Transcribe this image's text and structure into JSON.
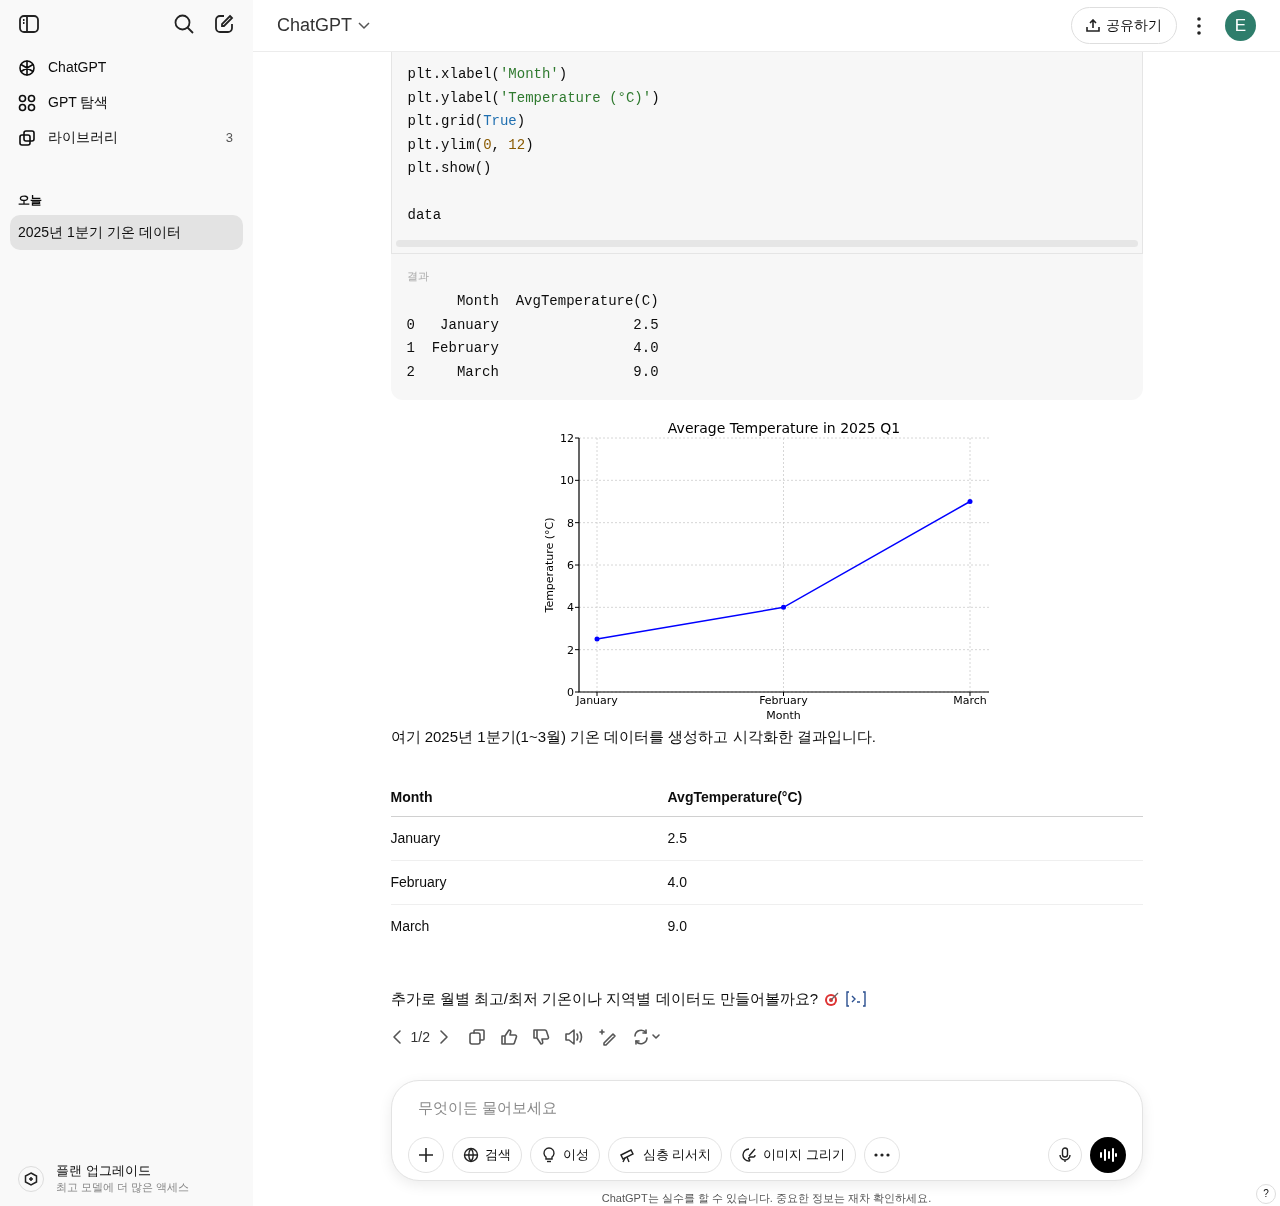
{
  "sidebar": {
    "nav": [
      {
        "label": "ChatGPT"
      },
      {
        "label": "GPT 탐색"
      },
      {
        "label": "라이브러리",
        "count": "3"
      }
    ],
    "section_label": "오늘",
    "chats": [
      {
        "title": "2025년 1분기 기온 데이터",
        "selected": true
      }
    ],
    "upgrade": {
      "title": "플랜 업그레이드",
      "subtitle": "최고 모델에 더 많은 액세스"
    }
  },
  "header": {
    "title": "ChatGPT",
    "share_label": "공유하기",
    "avatar_letter": "E"
  },
  "code": {
    "lines": [
      {
        "kind": "code",
        "tokens": [
          {
            "text": "plt.xlabel(",
            "kind": "plain"
          },
          {
            "text": "'Month'",
            "kind": "string"
          },
          {
            "text": ")",
            "kind": "plain"
          }
        ]
      },
      {
        "kind": "code",
        "tokens": [
          {
            "text": "plt.ylabel(",
            "kind": "plain"
          },
          {
            "text": "'Temperature (°C)'",
            "kind": "string"
          },
          {
            "text": ")",
            "kind": "plain"
          }
        ]
      },
      {
        "kind": "code",
        "tokens": [
          {
            "text": "plt.grid(",
            "kind": "plain"
          },
          {
            "text": "True",
            "kind": "keyword"
          },
          {
            "text": ")",
            "kind": "plain"
          }
        ]
      },
      {
        "kind": "code",
        "tokens": [
          {
            "text": "plt.ylim(",
            "kind": "plain"
          },
          {
            "text": "0",
            "kind": "number"
          },
          {
            "text": ", ",
            "kind": "plain"
          },
          {
            "text": "12",
            "kind": "number"
          },
          {
            "text": ")",
            "kind": "plain"
          }
        ]
      },
      {
        "kind": "code",
        "tokens": [
          {
            "text": "plt.show()",
            "kind": "plain"
          }
        ]
      },
      {
        "kind": "blank"
      },
      {
        "kind": "code",
        "tokens": [
          {
            "text": "data",
            "kind": "plain"
          }
        ]
      }
    ]
  },
  "result": {
    "label": "결과",
    "lines": [
      "      Month  AvgTemperature(C)",
      "0   January                2.5",
      "1  February                4.0",
      "2     March                9.0"
    ]
  },
  "chart_data": {
    "type": "line",
    "title": "Average Temperature in 2025 Q1",
    "xlabel": "Month",
    "ylabel": "Temperature (°C)",
    "categories": [
      "January",
      "February",
      "March"
    ],
    "series": [
      {
        "color": "#0000ff",
        "values": [
          2.5,
          4.0,
          9.0
        ]
      }
    ],
    "ylim": [
      0,
      12
    ],
    "yticks": [
      0,
      2,
      4,
      6,
      8,
      10,
      12
    ],
    "grid": true
  },
  "message": "여기 2025년 1분기(1~3월) 기온 데이터를 생성하고 시각화한 결과입니다.",
  "table": {
    "columns": [
      "Month",
      "AvgTemperature(°C)"
    ],
    "rows": [
      [
        "January",
        "2.5"
      ],
      [
        "February",
        "4.0"
      ],
      [
        "March",
        "9.0"
      ]
    ]
  },
  "follow_up": "추가로 월별 최고/최저 기온이나 지역별 데이터도 만들어볼까요?",
  "pager": "1/2",
  "composer": {
    "placeholder": "무엇이든 물어보세요",
    "tools": [
      "검색",
      "이성",
      "심층 리서치",
      "이미지 그리기"
    ]
  },
  "disclaimer": "ChatGPT는 실수를 할 수 있습니다. 중요한 정보는 재차 확인하세요.",
  "help": "?"
}
